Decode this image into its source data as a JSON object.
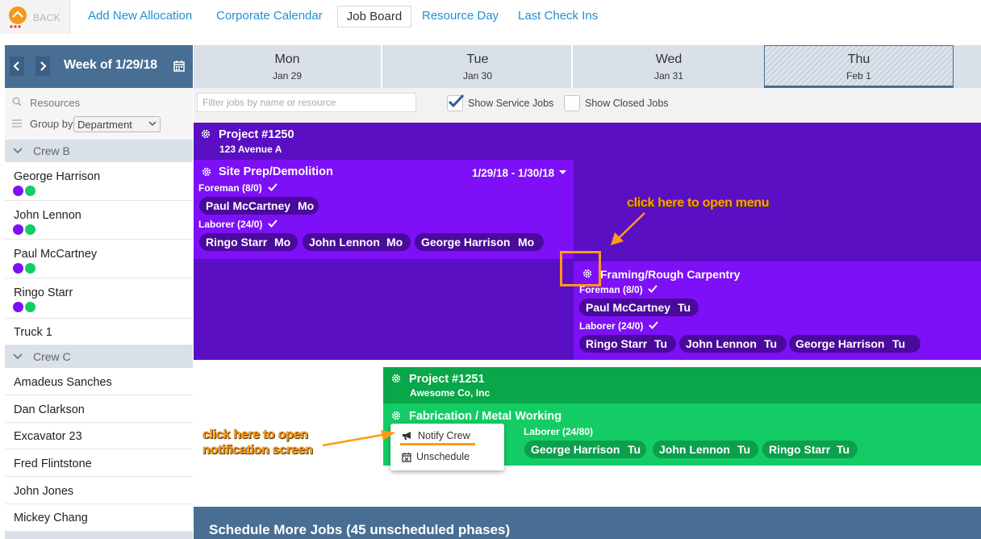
{
  "nav": {
    "back_label": "BACK",
    "links": [
      "Add New Allocation",
      "Corporate Calendar",
      "Job Board",
      "Resource Day",
      "Last Check Ins"
    ]
  },
  "week": {
    "label": "Week of 1/29/18"
  },
  "days": [
    {
      "name": "Mon",
      "date": "Jan 29"
    },
    {
      "name": "Tue",
      "date": "Jan 30"
    },
    {
      "name": "Wed",
      "date": "Jan 31"
    },
    {
      "name": "Thu",
      "date": "Feb 1"
    }
  ],
  "sidebar": {
    "resources_placeholder": "Resources",
    "group_by_label": "Group by",
    "group_by_value": "Department",
    "crews": [
      {
        "name": "Crew B",
        "members": [
          "George Harrison",
          "John Lennon",
          "Paul McCartney",
          "Ringo Starr",
          "Truck 1"
        ]
      },
      {
        "name": "Crew C",
        "members": [
          "Amadeus Sanches",
          "Dan Clarkson",
          "Excavator 23",
          "Fred Flintstone",
          "John Jones",
          "Mickey Chang"
        ]
      }
    ]
  },
  "filters": {
    "job_filter_placeholder": "Filter jobs by name or resource",
    "show_service_jobs": "Show Service Jobs",
    "show_service_jobs_checked": true,
    "show_closed_jobs": "Show Closed Jobs",
    "show_closed_jobs_checked": false
  },
  "projects": [
    {
      "title": "Project #1250",
      "subtitle": "123 Avenue A",
      "phases": [
        {
          "name": "Site Prep/Demolition",
          "dates": "1/29/18 - 1/30/18",
          "roles": [
            {
              "label": "Foreman (8/0)",
              "assigned": [
                {
                  "name": "Paul McCartney",
                  "day": "Mo"
                }
              ]
            },
            {
              "label": "Laborer (24/0)",
              "assigned": [
                {
                  "name": "Ringo Starr",
                  "day": "Mo"
                },
                {
                  "name": "John Lennon",
                  "day": "Mo"
                },
                {
                  "name": "George Harrison",
                  "day": "Mo"
                }
              ]
            }
          ]
        },
        {
          "name": "Framing/Rough Carpentry",
          "roles": [
            {
              "label": "Foreman (8/0)",
              "assigned": [
                {
                  "name": "Paul McCartney",
                  "day": "Tu"
                }
              ]
            },
            {
              "label": "Laborer (24/0)",
              "assigned": [
                {
                  "name": "Ringo Starr",
                  "day": "Tu"
                },
                {
                  "name": "John Lennon",
                  "day": "Tu"
                },
                {
                  "name": "George Harrison",
                  "day": "Tu"
                }
              ]
            }
          ]
        }
      ]
    },
    {
      "title": "Project #1251",
      "subtitle": "Awesome Co, Inc",
      "phases": [
        {
          "name": "Fabrication / Metal Working",
          "roles": [
            {
              "label": "Laborer (24/80)",
              "assigned": [
                {
                  "name": "George Harrison",
                  "day": "Tu"
                },
                {
                  "name": "John Lennon",
                  "day": "Tu"
                },
                {
                  "name": "Ringo Starr",
                  "day": "Tu"
                }
              ]
            }
          ]
        }
      ]
    }
  ],
  "context_menu": {
    "items": [
      "Notify Crew",
      "Unschedule"
    ]
  },
  "annotations": {
    "menu_hint": "click here to open menu",
    "notify_hint_line1": "click here to open",
    "notify_hint_line2": "notification screen"
  },
  "bottom_bar": {
    "label": "Schedule More Jobs (45 unscheduled phases)"
  },
  "colors": {
    "project_dark_purple": "#5a0fc2",
    "phase_purple": "#7d10f6",
    "pill_purple": "#4a0a9c",
    "project_green": "#0aa64a",
    "phase_green": "#14cc65",
    "pill_green": "#0c9f4c",
    "nav_blue": "#1f8fd6",
    "header_blue": "#486e93",
    "annotation_orange": "#ff9a1a"
  }
}
